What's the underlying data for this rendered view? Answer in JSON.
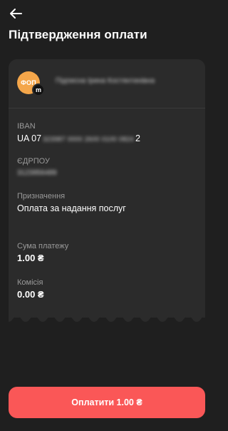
{
  "header": {
    "title": "Підтвердження оплати",
    "back_icon": "arrow-left-icon"
  },
  "recipient": {
    "avatar_text": "ФОП",
    "bank_badge_text": "m",
    "name_obscured": "Підписна Ірина Костянтинівна"
  },
  "details": {
    "iban": {
      "label": "IBAN",
      "prefix": "UA 07",
      "obscured": "323987 0000 2600 0100 0824",
      "suffix": "2"
    },
    "edrpou": {
      "label": "ЄДРПОУ",
      "obscured": "3123956489"
    },
    "purpose": {
      "label": "Призначення",
      "value": "Оплата за надання послуг"
    },
    "amount": {
      "label": "Сума платежу",
      "value": "1.00 ₴"
    },
    "fee": {
      "label": "Комісія",
      "value": "0.00 ₴"
    }
  },
  "actions": {
    "pay_label": "Оплатити 1.00 ₴"
  },
  "colors": {
    "background": "#1f1f1f",
    "card": "#2b2b2b",
    "avatar": "#f4a64a",
    "pay_button": "#fa5757"
  }
}
